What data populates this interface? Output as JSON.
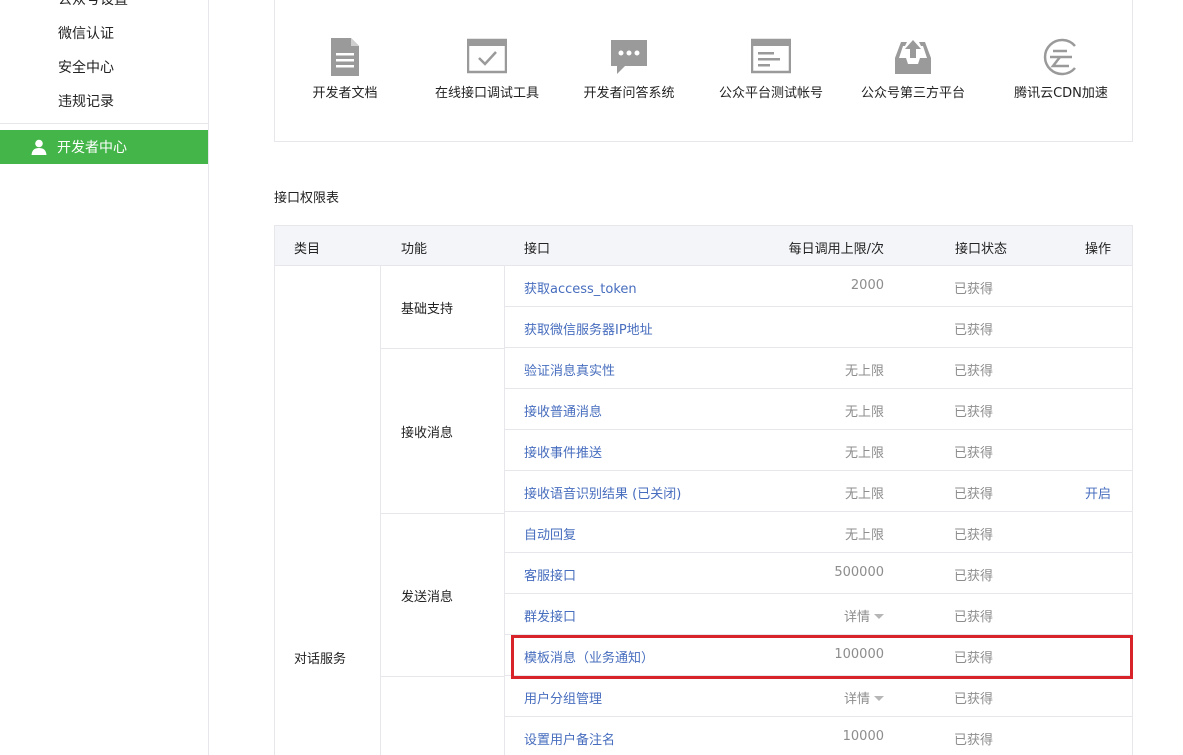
{
  "sidebar": {
    "items": [
      {
        "label": "公众号设置"
      },
      {
        "label": "微信认证"
      },
      {
        "label": "安全中心"
      },
      {
        "label": "违规记录"
      }
    ],
    "active": {
      "label": "开发者中心",
      "icon": "person-icon"
    }
  },
  "tools": [
    {
      "label": "开发者文档",
      "icon": "document-icon"
    },
    {
      "label": "在线接口调试工具",
      "icon": "debug-window-icon"
    },
    {
      "label": "开发者问答系统",
      "icon": "chat-bubble-icon"
    },
    {
      "label": "公众平台测试帐号",
      "icon": "test-account-icon"
    },
    {
      "label": "公众号第三方平台",
      "icon": "upload-tray-icon"
    },
    {
      "label": "腾讯云CDN加速",
      "icon": "cdn-icon"
    }
  ],
  "section_title": "接口权限表",
  "table": {
    "headers": {
      "category": "类目",
      "function": "功能",
      "api": "接口",
      "limit": "每日调用上限/次",
      "status": "接口状态",
      "action": "操作"
    },
    "category": "对话服务",
    "groups": [
      "基础支持",
      "接收消息",
      "发送消息"
    ],
    "rows": [
      {
        "api": "获取access_token",
        "limit": "2000",
        "status": "已获得",
        "action": ""
      },
      {
        "api": "获取微信服务器IP地址",
        "limit": "",
        "status": "已获得",
        "action": ""
      },
      {
        "api": "验证消息真实性",
        "limit": "无上限",
        "status": "已获得",
        "action": ""
      },
      {
        "api": "接收普通消息",
        "limit": "无上限",
        "status": "已获得",
        "action": ""
      },
      {
        "api": "接收事件推送",
        "limit": "无上限",
        "status": "已获得",
        "action": ""
      },
      {
        "api": "接收语音识别结果 (已关闭)",
        "limit": "无上限",
        "status": "已获得",
        "action": "开启"
      },
      {
        "api": "自动回复",
        "limit": "无上限",
        "status": "已获得",
        "action": ""
      },
      {
        "api": "客服接口",
        "limit": "500000",
        "status": "已获得",
        "action": ""
      },
      {
        "api": "群发接口",
        "limit": "详情",
        "status": "已获得",
        "action": ""
      },
      {
        "api": "模板消息（业务通知）",
        "limit": "100000",
        "status": "已获得",
        "action": ""
      },
      {
        "api": "用户分组管理",
        "limit": "详情",
        "status": "已获得",
        "action": ""
      },
      {
        "api": "设置用户备注名",
        "limit": "10000",
        "status": "已获得",
        "action": ""
      }
    ]
  },
  "colors": {
    "accent_green": "#44b549",
    "link_blue": "#476dbe",
    "highlight_red": "#d9232a",
    "icon_gray": "#9a9a9a"
  }
}
